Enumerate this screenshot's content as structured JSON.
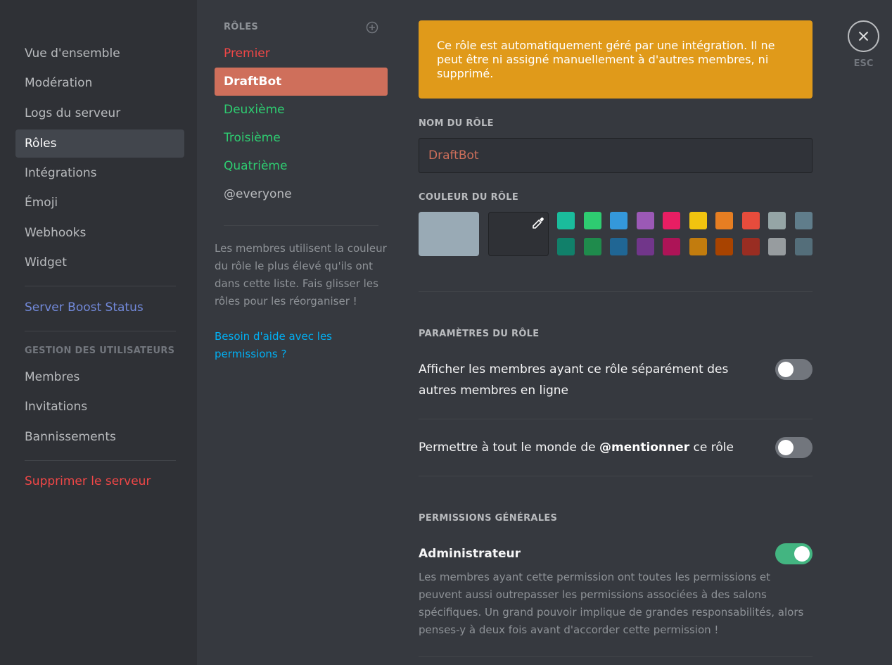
{
  "sidebar": {
    "items": [
      {
        "label": "Vue d'ensemble"
      },
      {
        "label": "Modération"
      },
      {
        "label": "Logs du serveur"
      },
      {
        "label": "Rôles"
      },
      {
        "label": "Intégrations"
      },
      {
        "label": "Émoji"
      },
      {
        "label": "Webhooks"
      },
      {
        "label": "Widget"
      }
    ],
    "boost_label": "Server Boost Status",
    "user_mgmt_header": "GESTION DES UTILISATEURS",
    "user_items": [
      {
        "label": "Membres"
      },
      {
        "label": "Invitations"
      },
      {
        "label": "Bannissements"
      }
    ],
    "delete_label": "Supprimer le serveur"
  },
  "roles": {
    "header": "RÔLES",
    "list": [
      {
        "label": "Premier",
        "color": "#f04747"
      },
      {
        "label": "DraftBot",
        "color": "#ffffff"
      },
      {
        "label": "Deuxième",
        "color": "#2ecc71"
      },
      {
        "label": "Troisième",
        "color": "#2ecc71"
      },
      {
        "label": "Quatrième",
        "color": "#2ecc71"
      },
      {
        "label": "@everyone",
        "color": "#b9bbbe"
      }
    ],
    "help_text": "Les membres utilisent la couleur du rôle le plus élevé qu'ils ont dans cette liste. Fais glisser les rôles pour les réorganiser !",
    "help_link": "Besoin d'aide avec les permissions ?"
  },
  "main": {
    "warning": "Ce rôle est automatiquement géré par une intégration. Il ne peut être ni assigné manuellement à d'autres membres, ni supprimé.",
    "role_name_label": "NOM DU RÔLE",
    "role_name_value": "DraftBot",
    "role_color_label": "COULEUR DU RÔLE",
    "default_color": "#99aab5",
    "swatches_row1": [
      "#1abc9c",
      "#2ecc71",
      "#3498db",
      "#9b59b6",
      "#e91e63",
      "#f1c40f",
      "#e67e22",
      "#e74c3c",
      "#95a5a6",
      "#607d8b"
    ],
    "swatches_row2": [
      "#11806a",
      "#1f8b4c",
      "#206694",
      "#71368a",
      "#ad1457",
      "#c27c0e",
      "#a84300",
      "#992d22",
      "#979c9f",
      "#546e7a"
    ],
    "settings_label": "PARAMÈTRES DU RÔLE",
    "setting_hoist": "Afficher les membres ayant ce rôle séparément des autres membres en ligne",
    "setting_mention_prefix": "Permettre à tout le monde de ",
    "setting_mention_bold": "@mentionner",
    "setting_mention_suffix": " ce rôle",
    "hoist_enabled": false,
    "mention_enabled": false,
    "general_perms_label": "PERMISSIONS GÉNÉRALES",
    "admin_label": "Administrateur",
    "admin_enabled": true,
    "admin_desc": "Les membres ayant cette permission ont toutes les permissions et peuvent aussi outrepasser les permissions associées à des salons spécifiques. Un grand pouvoir implique de grandes responsabilités, alors penses-y à deux fois avant d'accorder cette permission !"
  },
  "close": {
    "esc_label": "ESC"
  }
}
